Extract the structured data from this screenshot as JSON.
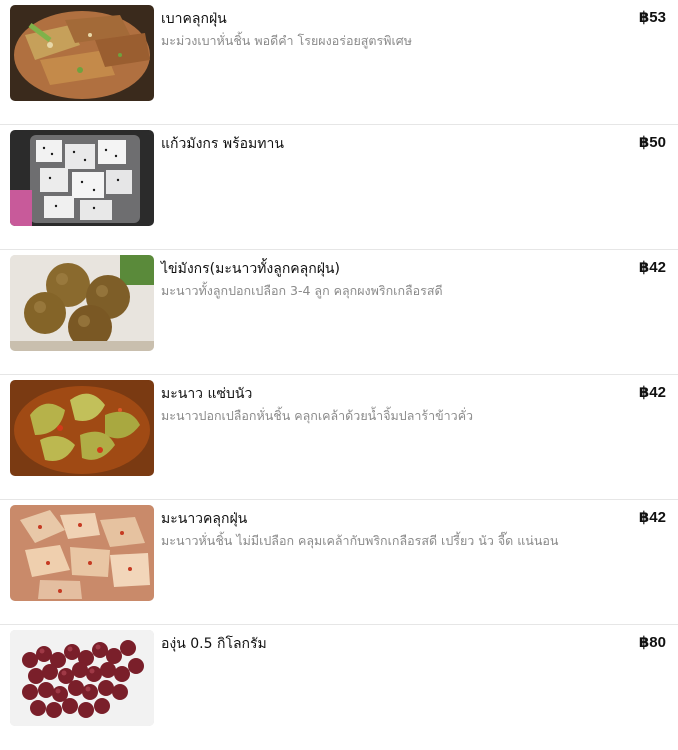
{
  "menu": {
    "items": [
      {
        "name": "เบาคลุกฝุ่น",
        "description": "มะม่วงเบาหั่นชิ้น พอดีคำ โรยผงอร่อยสูตรพิเศษ",
        "price": "฿53",
        "image_icon": "mango-with-spice-photo"
      },
      {
        "name": "แก้วมังกร พร้อมทาน",
        "description": "",
        "price": "฿50",
        "image_icon": "dragon-fruit-photo"
      },
      {
        "name": "ไข่มังกร(มะนาวทั้งลูกคลุกฝุ่น)",
        "description": "มะนาวทั้งลูกปอกเปลือก 3-4 ลูก คลุกผงพริกเกลือรสดี",
        "price": "฿42",
        "image_icon": "spiced-lime-balls-photo"
      },
      {
        "name": "มะนาว แซ่บนัว",
        "description": "มะนาวปอกเปลือกหั่นชิ้น คลุกเคล้าด้วยน้ำจิ้มปลาร้าข้าวคั่ว",
        "price": "฿42",
        "image_icon": "lime-in-sauce-photo"
      },
      {
        "name": "มะนาวคลุกฝุ่น",
        "description": "มะนาวหั่นชิ้น ไม่มีเปลือก คลุมเคล้ากับพริกเกลือรสดี เปรี้ยว นัว จี๊ด แน่นอน",
        "price": "฿42",
        "image_icon": "chili-lime-slices-photo"
      },
      {
        "name": "องุ่น 0.5 กิโลกรัม",
        "description": "",
        "price": "฿80",
        "image_icon": "red-grapes-photo"
      }
    ]
  }
}
